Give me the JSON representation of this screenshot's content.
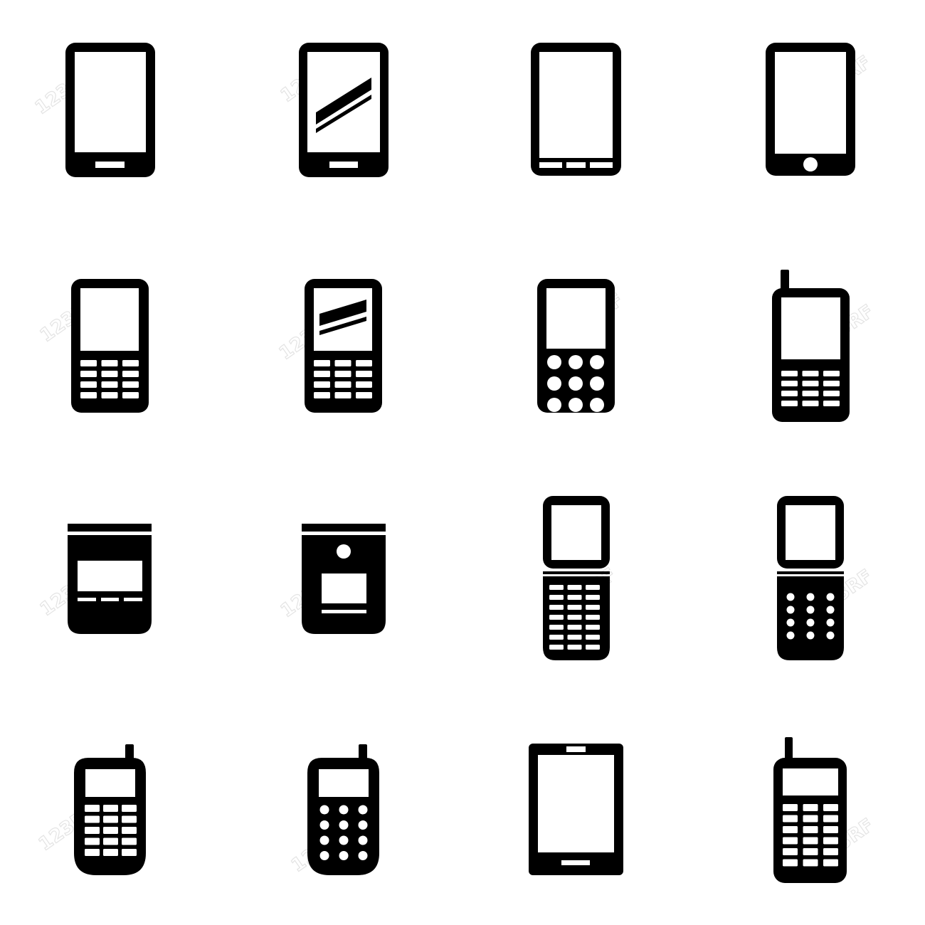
{
  "colors": {
    "background": "#ffffff",
    "icon": "#000000",
    "screen": "#ffffff",
    "watermark": "#e4e4e4"
  },
  "watermark": {
    "text": "123RF"
  },
  "icons": [
    {
      "name": "smartphone-bar-button-icon"
    },
    {
      "name": "smartphone-glare-screen-icon"
    },
    {
      "name": "smartphone-three-buttons-icon"
    },
    {
      "name": "tablet-round-home-button-icon"
    },
    {
      "name": "keypad-phone-square-keys-icon"
    },
    {
      "name": "keypad-phone-glare-screen-icon"
    },
    {
      "name": "keypad-phone-round-keys-icon"
    },
    {
      "name": "antenna-keypad-phone-icon"
    },
    {
      "name": "flip-phone-closed-wide-display-icon"
    },
    {
      "name": "flip-phone-closed-camera-icon"
    },
    {
      "name": "flip-phone-open-square-keys-icon"
    },
    {
      "name": "flip-phone-open-round-keys-icon"
    },
    {
      "name": "antenna-phone-square-keys-icon"
    },
    {
      "name": "antenna-phone-round-keys-icon"
    },
    {
      "name": "tablet-speaker-bar-icon"
    },
    {
      "name": "antenna-brick-phone-icon"
    }
  ]
}
